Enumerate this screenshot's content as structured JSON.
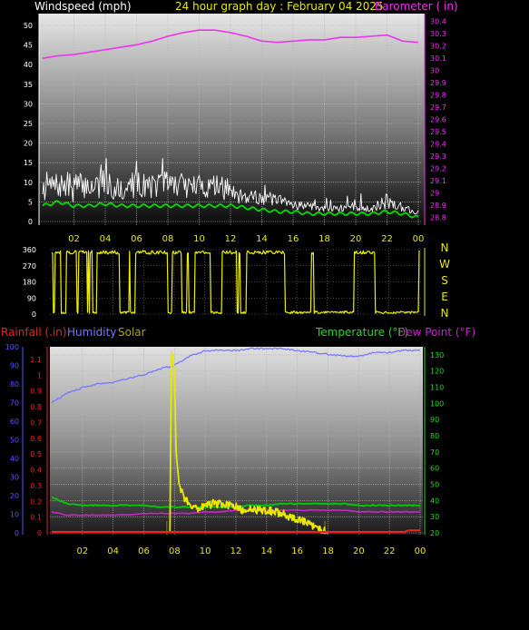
{
  "colors": {
    "wind": "#ffffff",
    "gust": "#ffffff",
    "wind_avg": "#00dd00",
    "baro": "#ee33ee",
    "winddir": "#eeee00",
    "rain": "#ee2222",
    "humidity": "#7777ff",
    "solar": "#e8e800",
    "temperature": "#00cc00",
    "dewpoint": "#cc22cc",
    "title_yellow": "#e8e800",
    "axis_left_blue": "#5555ff",
    "axis_right_green": "#22dd22"
  },
  "header": {
    "windspeed_label": "Windspeed (mph)",
    "title": "24 hour graph day : February 04 2025",
    "barometer_label": "Barometer ( in)",
    "direction_letters": [
      "N",
      "W",
      "S",
      "E",
      "N"
    ]
  },
  "legend2": {
    "rainfall": "Rainfall (.in)",
    "humidity": "Humidity",
    "solar": "Solar",
    "temperature": "Temperature (°F)",
    "dewpoint": "Dew Point (°F)"
  },
  "chart_data": [
    {
      "type": "line",
      "title": "24 hour graph day : February 04 2025",
      "x_tick_labels": [
        "02",
        "04",
        "06",
        "08",
        "10",
        "12",
        "14",
        "16",
        "18",
        "20",
        "22",
        "00"
      ],
      "x_hours_range": [
        0,
        24
      ],
      "y_left_label": "Windspeed (mph)",
      "y_left_ticks": [
        0,
        5,
        10,
        15,
        20,
        25,
        30,
        35,
        40,
        45,
        50
      ],
      "y_left_lim": [
        0,
        50
      ],
      "y_right_label": "Barometer ( in)",
      "y_right_ticks": [
        "28.8",
        "28.9",
        "29",
        "29.1",
        "29.2",
        "29.3",
        "29.4",
        "29.5",
        "29.6",
        "29.7",
        "29.8",
        "29.9",
        "30",
        "30.1",
        "30.2",
        "30.3",
        "30.4"
      ],
      "y_right_lim": [
        28.75,
        30.45
      ],
      "series": [
        {
          "name": "Barometer",
          "axis": "right",
          "x": [
            0,
            1,
            2,
            3,
            4,
            5,
            6,
            7,
            8,
            9,
            10,
            11,
            12,
            13,
            14,
            15,
            16,
            17,
            18,
            19,
            20,
            21,
            22,
            23,
            24
          ],
          "values": [
            30.1,
            30.12,
            30.13,
            30.15,
            30.17,
            30.19,
            30.21,
            30.24,
            30.28,
            30.31,
            30.33,
            30.33,
            30.31,
            30.28,
            30.24,
            30.23,
            30.24,
            30.25,
            30.25,
            30.27,
            30.27,
            30.28,
            30.29,
            30.24,
            30.23
          ]
        },
        {
          "name": "Wind avg",
          "axis": "left",
          "x": [
            0,
            1,
            2,
            3,
            4,
            5,
            6,
            7,
            8,
            9,
            10,
            11,
            12,
            13,
            14,
            15,
            16,
            17,
            18,
            19,
            20,
            21,
            22,
            23,
            24
          ],
          "values": [
            4,
            5,
            4,
            4,
            4.5,
            4,
            4,
            4,
            4,
            4,
            4,
            4,
            4,
            3.5,
            3,
            2.5,
            2.5,
            2,
            2,
            2,
            2,
            2,
            2.5,
            2,
            1
          ]
        },
        {
          "name": "Wind gust",
          "axis": "left",
          "x": [
            0,
            1,
            2,
            3,
            4,
            5,
            6,
            7,
            8,
            9,
            10,
            11,
            12,
            13,
            14,
            15,
            16,
            17,
            18,
            19,
            20,
            21,
            22,
            23,
            24
          ],
          "values": [
            13,
            12,
            13,
            12,
            14,
            12,
            13,
            12,
            14,
            12,
            12,
            12,
            11,
            10,
            8,
            7,
            6,
            5,
            4,
            4,
            5,
            4,
            7,
            5,
            3
          ]
        },
        {
          "name": "Wind low",
          "axis": "left",
          "x": [
            0,
            1,
            2,
            3,
            4,
            5,
            6,
            7,
            8,
            9,
            10,
            11,
            12,
            13,
            14,
            15,
            16,
            17,
            18,
            19,
            20,
            21,
            22,
            23,
            24
          ],
          "values": [
            5,
            6,
            5,
            6,
            5,
            5,
            6,
            6,
            6,
            6,
            6,
            6,
            5,
            4,
            4,
            3,
            3,
            3,
            2.5,
            2.5,
            2.5,
            2.5,
            3,
            2.5,
            1
          ]
        }
      ]
    },
    {
      "type": "line",
      "x_tick_labels": [
        "02",
        "04",
        "06",
        "08",
        "10",
        "12",
        "14",
        "16",
        "18",
        "20",
        "22",
        "00"
      ],
      "y_left_ticks": [
        0,
        90,
        180,
        270,
        360
      ],
      "y_left_lim": [
        0,
        360
      ],
      "y_right_labels": [
        "N",
        "W",
        "S",
        "E",
        "N"
      ],
      "series": [
        {
          "name": "Wind direction",
          "x": [
            0,
            1,
            2,
            3,
            4,
            5,
            6,
            7,
            8,
            9,
            10,
            11,
            12,
            13,
            14,
            15,
            16,
            17,
            18,
            19,
            20,
            21,
            22,
            23,
            24
          ],
          "values": [
            340,
            10,
            340,
            5,
            345,
            10,
            340,
            5,
            340,
            345,
            350,
            345,
            350,
            340,
            345,
            340,
            10,
            340,
            5,
            345,
            340,
            345,
            340,
            10,
            10
          ]
        }
      ]
    },
    {
      "type": "line",
      "x_tick_labels": [
        "02",
        "04",
        "06",
        "08",
        "10",
        "12",
        "14",
        "16",
        "18",
        "20",
        "22",
        "00"
      ],
      "y_left_outer_ticks": [
        0,
        10,
        20,
        30,
        40,
        50,
        60,
        70,
        80,
        90,
        100
      ],
      "y_left_inner_ticks": [
        "0",
        "0.1",
        "0.2",
        "0.3",
        "0.4",
        "0.5",
        "0.6",
        "0.7",
        "0.8",
        "0.9",
        "1",
        "1.1"
      ],
      "y_right_ticks": [
        20,
        30,
        40,
        50,
        60,
        70,
        80,
        90,
        100,
        110,
        120,
        130
      ],
      "y_right_lim": [
        20,
        135
      ],
      "series": [
        {
          "name": "Humidity",
          "axis": "outer_left",
          "x": [
            0,
            1,
            2,
            3,
            4,
            5,
            6,
            7,
            8,
            9,
            10,
            11,
            12,
            13,
            14,
            15,
            16,
            17,
            18,
            19,
            20,
            21,
            22,
            23,
            24
          ],
          "values": [
            70,
            75,
            78,
            80,
            81,
            83,
            85,
            88,
            90,
            95,
            98,
            98,
            98,
            99,
            99,
            99,
            98,
            97,
            96,
            95,
            95,
            97,
            97,
            98,
            98
          ]
        },
        {
          "name": "Temperature",
          "axis": "right",
          "x": [
            0,
            1,
            2,
            3,
            4,
            5,
            6,
            7,
            8,
            9,
            10,
            11,
            12,
            13,
            14,
            15,
            16,
            17,
            18,
            19,
            20,
            21,
            22,
            23,
            24
          ],
          "values": [
            42,
            38,
            37,
            37,
            37,
            37,
            37,
            36,
            36,
            36,
            36,
            36,
            36,
            37,
            37,
            38,
            38,
            38,
            38,
            38,
            37,
            37,
            37,
            37,
            37
          ]
        },
        {
          "name": "Dew Point",
          "axis": "right",
          "x": [
            0,
            1,
            2,
            3,
            4,
            5,
            6,
            7,
            8,
            9,
            10,
            11,
            12,
            13,
            14,
            15,
            16,
            17,
            18,
            19,
            20,
            21,
            22,
            23,
            24
          ],
          "values": [
            33,
            31,
            31,
            31,
            31,
            31,
            32,
            32,
            32,
            32,
            33,
            33,
            34,
            34,
            34,
            34,
            34,
            34,
            34,
            34,
            33,
            33,
            33,
            33,
            33
          ]
        },
        {
          "name": "Solar",
          "axis": "right",
          "x": [
            7.7,
            7.8,
            8.0,
            8.1,
            8.3,
            8.6,
            9.0,
            9.5,
            10,
            10.5,
            11,
            11.5,
            12,
            12.5,
            13,
            13.5,
            14,
            14.5,
            15,
            15.5,
            16,
            16.5,
            17,
            17.5,
            18
          ],
          "values": [
            20,
            133,
            120,
            70,
            50,
            42,
            38,
            35,
            37,
            38,
            38,
            37,
            36,
            33,
            35,
            34,
            34,
            33,
            32,
            30,
            28,
            27,
            24,
            22,
            20
          ]
        },
        {
          "name": "Rainfall",
          "axis": "inner_left",
          "x": [
            0,
            23,
            23.2,
            24
          ],
          "values": [
            0,
            0,
            0.01,
            0.01
          ]
        }
      ]
    }
  ]
}
